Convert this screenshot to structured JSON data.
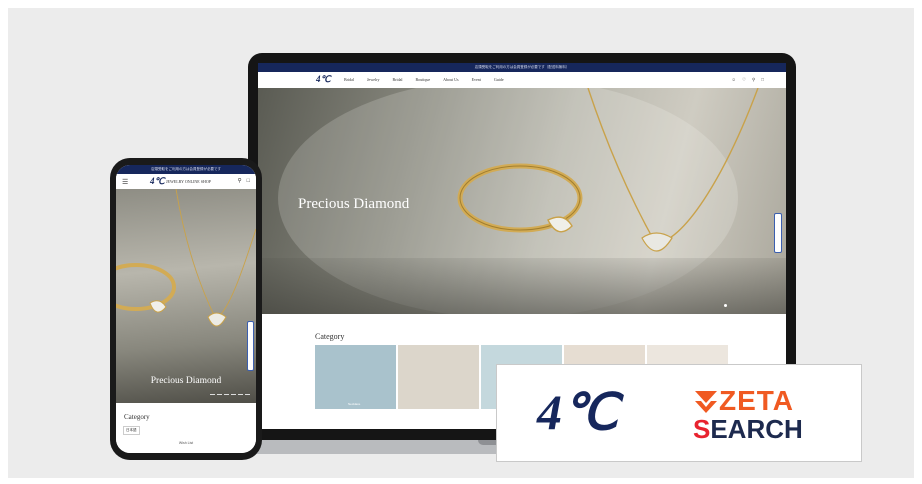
{
  "desktop": {
    "announcement": "店頭受取をご利用の方は会員登録が必要です（配送料無料）",
    "brand_mark": "4℃",
    "nav": [
      "Bridal",
      "Jewelry",
      "Bridal",
      "Boutique",
      "About Us",
      "Event",
      "Guide"
    ],
    "hero_title": "Precious Diamond",
    "category_title": "Category",
    "category_first_label": "Necklace",
    "thumb_colors": [
      "#a9c2cc",
      "#dcd6cb",
      "#c4d8dd",
      "#e6ddd2",
      "#ece6de"
    ]
  },
  "mobile": {
    "announcement": "店頭受取をご利用の方は会員登録が必要です",
    "brand_mark": "4℃",
    "shop_name": "JEWELRY ONLINE SHOP",
    "hero_title": "Precious Diamond",
    "category_title": "Category",
    "language": "日本語",
    "footer": "Wish List"
  },
  "logos": {
    "brand_4c": "4℃",
    "zeta_word": "ZETA",
    "search_first": "S",
    "search_rest": "EARCH"
  },
  "colors": {
    "navy": "#16275c",
    "zeta_orange": "#f05a22",
    "search_red": "#e8232f",
    "search_navy": "#1d2a4e"
  },
  "icons": [
    "hamburger-icon",
    "search-icon",
    "cart-icon",
    "account-icon",
    "heart-icon",
    "zeta-mark-icon"
  ]
}
